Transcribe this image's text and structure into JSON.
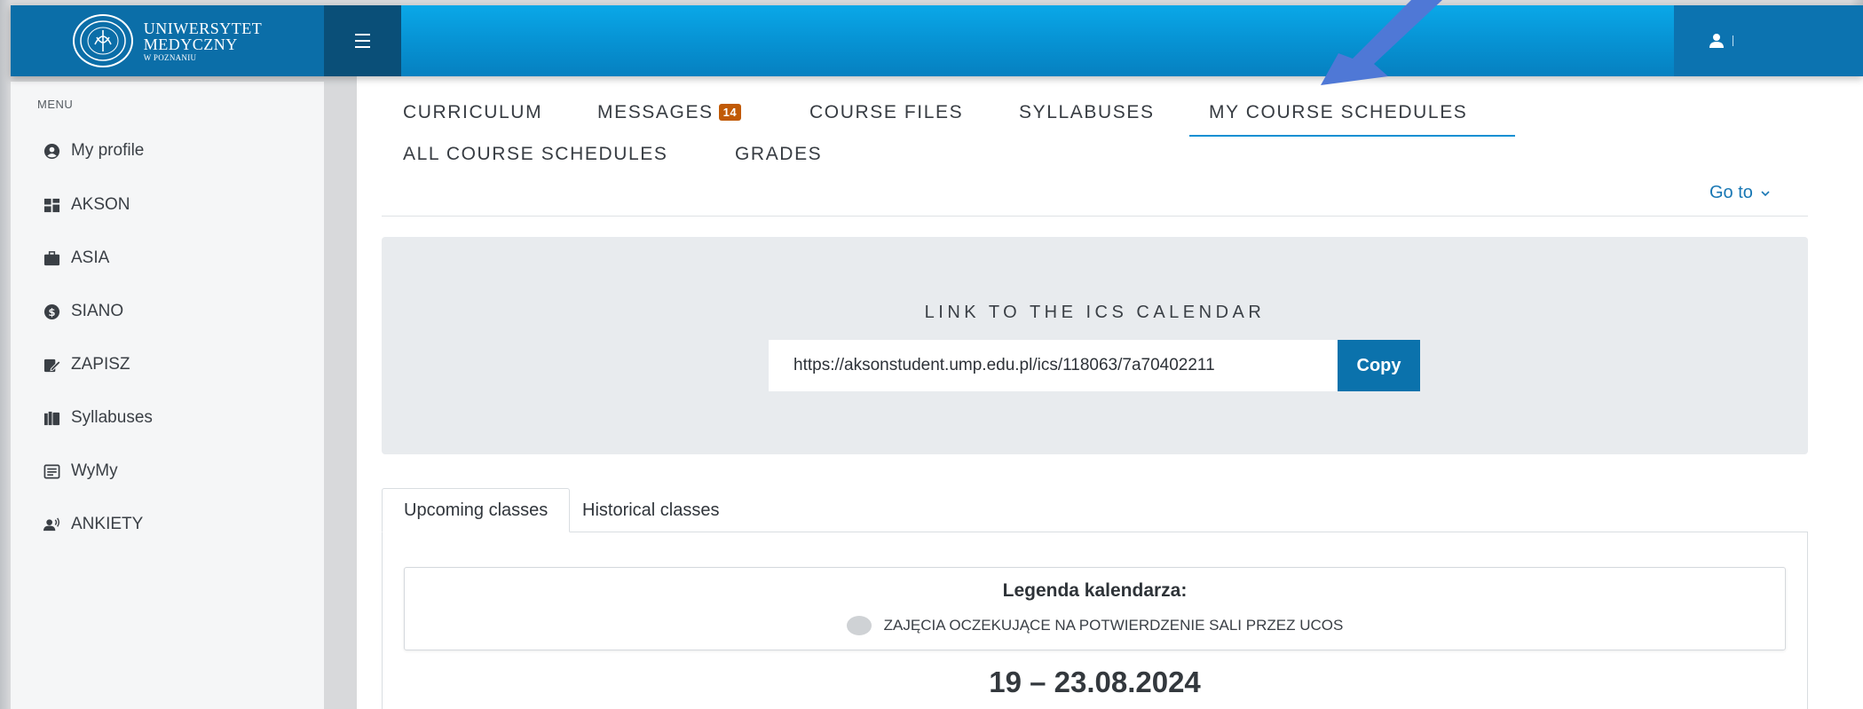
{
  "header": {
    "logo": {
      "line1": "UNIWERSYTET",
      "line2": "MEDYCZNY",
      "line3": "W POZNANIU"
    },
    "menu_icon": "hamburger-icon",
    "user_icon": "user-icon",
    "colors": {
      "brand": "#0b6ea8",
      "bar": "#0795d6",
      "accent_dark": "#0a4f78"
    }
  },
  "sidebar": {
    "menu_label": "MENU",
    "items": [
      {
        "label": "My profile",
        "icon": "user-circle-icon"
      },
      {
        "label": "AKSON",
        "icon": "dashboard-icon"
      },
      {
        "label": "ASIA",
        "icon": "briefcase-icon"
      },
      {
        "label": "SIANO",
        "icon": "coin-icon"
      },
      {
        "label": "ZAPISZ",
        "icon": "edit-icon"
      },
      {
        "label": "Syllabuses",
        "icon": "books-icon"
      },
      {
        "label": "WyMy",
        "icon": "form-icon"
      },
      {
        "label": "ANKIETY",
        "icon": "survey-icon"
      }
    ]
  },
  "main": {
    "nav_tabs": {
      "curriculum": "CURRICULUM",
      "messages": "MESSAGES",
      "messages_count": "14",
      "course_files": "COURSE FILES",
      "syllabuses": "SYLLABUSES",
      "my_course_schedules": "MY COURSE SCHEDULES",
      "all_course_schedules": "ALL COURSE SCHEDULES",
      "grades": "GRADES",
      "active": "MY COURSE SCHEDULES"
    },
    "goto_label": "Go to",
    "ics": {
      "title": "LINK TO THE ICS CALENDAR",
      "url": "https://aksonstudent.ump.edu.pl/ics/118063/7a70402211",
      "copy_label": "Copy"
    },
    "class_tabs": {
      "upcoming": "Upcoming classes",
      "historical": "Historical classes",
      "active": "Upcoming classes"
    },
    "legend": {
      "title": "Legenda kalendarza:",
      "item": "ZAJĘCIA OCZEKUJĄCE NA POTWIERDZENIE SALI PRZEZ UCOS",
      "dot_color": "#cfd2d5"
    },
    "week_range": "19 – 23.08.2024"
  }
}
